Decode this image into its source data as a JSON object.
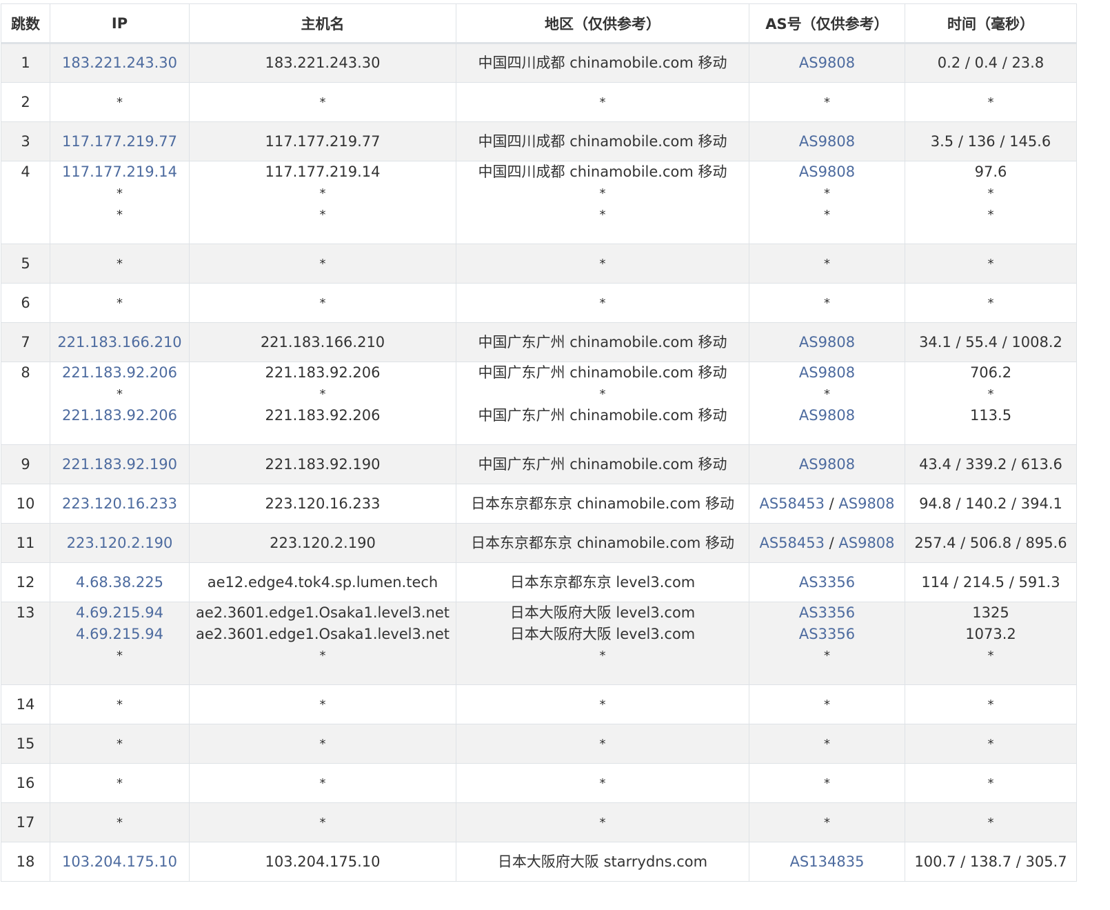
{
  "headers": [
    "跳数",
    "IP",
    "主机名",
    "地区（仅供参考）",
    "AS号（仅供参考）",
    "时间（毫秒）"
  ],
  "rows": [
    {
      "hop": "1",
      "lines": [
        {
          "ip": "183.221.243.30",
          "host": "183.221.243.30",
          "region": "中国四川成都 chinamobile.com 移动",
          "as": [
            "AS9808"
          ],
          "time": "0.2 / 0.4 / 23.8"
        }
      ]
    },
    {
      "hop": "2",
      "lines": [
        {
          "ip": "*",
          "host": "*",
          "region": "*",
          "as": [],
          "time": "*"
        }
      ]
    },
    {
      "hop": "3",
      "lines": [
        {
          "ip": "117.177.219.77",
          "host": "117.177.219.77",
          "region": "中国四川成都 chinamobile.com 移动",
          "as": [
            "AS9808"
          ],
          "time": "3.5 / 136 / 145.6"
        }
      ]
    },
    {
      "hop": "4",
      "lines": [
        {
          "ip": "117.177.219.14",
          "host": "117.177.219.14",
          "region": "中国四川成都 chinamobile.com 移动",
          "as": [
            "AS9808"
          ],
          "time": "97.6"
        },
        {
          "ip": "*",
          "host": "*",
          "region": "*",
          "as": [],
          "time": "*"
        },
        {
          "ip": "*",
          "host": "*",
          "region": "*",
          "as": [],
          "time": "*"
        }
      ]
    },
    {
      "hop": "5",
      "lines": [
        {
          "ip": "*",
          "host": "*",
          "region": "*",
          "as": [],
          "time": "*"
        }
      ]
    },
    {
      "hop": "6",
      "lines": [
        {
          "ip": "*",
          "host": "*",
          "region": "*",
          "as": [],
          "time": "*"
        }
      ]
    },
    {
      "hop": "7",
      "lines": [
        {
          "ip": "221.183.166.210",
          "host": "221.183.166.210",
          "region": "中国广东广州 chinamobile.com 移动",
          "as": [
            "AS9808"
          ],
          "time": "34.1 / 55.4 / 1008.2"
        }
      ]
    },
    {
      "hop": "8",
      "lines": [
        {
          "ip": "221.183.92.206",
          "host": "221.183.92.206",
          "region": "中国广东广州 chinamobile.com 移动",
          "as": [
            "AS9808"
          ],
          "time": "706.2"
        },
        {
          "ip": "*",
          "host": "*",
          "region": "*",
          "as": [],
          "time": "*"
        },
        {
          "ip": "221.183.92.206",
          "host": "221.183.92.206",
          "region": "中国广东广州 chinamobile.com 移动",
          "as": [
            "AS9808"
          ],
          "time": "113.5"
        }
      ]
    },
    {
      "hop": "9",
      "lines": [
        {
          "ip": "221.183.92.190",
          "host": "221.183.92.190",
          "region": "中国广东广州 chinamobile.com 移动",
          "as": [
            "AS9808"
          ],
          "time": "43.4 / 339.2 / 613.6"
        }
      ]
    },
    {
      "hop": "10",
      "lines": [
        {
          "ip": "223.120.16.233",
          "host": "223.120.16.233",
          "region": "日本东京都东京 chinamobile.com 移动",
          "as": [
            "AS58453",
            "AS9808"
          ],
          "time": "94.8 / 140.2 / 394.1"
        }
      ]
    },
    {
      "hop": "11",
      "lines": [
        {
          "ip": "223.120.2.190",
          "host": "223.120.2.190",
          "region": "日本东京都东京 chinamobile.com 移动",
          "as": [
            "AS58453",
            "AS9808"
          ],
          "time": "257.4 / 506.8 / 895.6"
        }
      ]
    },
    {
      "hop": "12",
      "lines": [
        {
          "ip": "4.68.38.225",
          "host": "ae12.edge4.tok4.sp.lumen.tech",
          "region": "日本东京都东京 level3.com",
          "as": [
            "AS3356"
          ],
          "time": "114 / 214.5 / 591.3"
        }
      ]
    },
    {
      "hop": "13",
      "lines": [
        {
          "ip": "4.69.215.94",
          "host": "ae2.3601.edge1.Osaka1.level3.net",
          "region": "日本大阪府大阪 level3.com",
          "as": [
            "AS3356"
          ],
          "time": "1325"
        },
        {
          "ip": "4.69.215.94",
          "host": "ae2.3601.edge1.Osaka1.level3.net",
          "region": "日本大阪府大阪 level3.com",
          "as": [
            "AS3356"
          ],
          "time": "1073.2"
        },
        {
          "ip": "*",
          "host": "*",
          "region": "*",
          "as": [],
          "time": "*"
        }
      ]
    },
    {
      "hop": "14",
      "lines": [
        {
          "ip": "*",
          "host": "*",
          "region": "*",
          "as": [],
          "time": "*"
        }
      ]
    },
    {
      "hop": "15",
      "lines": [
        {
          "ip": "*",
          "host": "*",
          "region": "*",
          "as": [],
          "time": "*"
        }
      ]
    },
    {
      "hop": "16",
      "lines": [
        {
          "ip": "*",
          "host": "*",
          "region": "*",
          "as": [],
          "time": "*"
        }
      ]
    },
    {
      "hop": "17",
      "lines": [
        {
          "ip": "*",
          "host": "*",
          "region": "*",
          "as": [],
          "time": "*"
        }
      ]
    },
    {
      "hop": "18",
      "lines": [
        {
          "ip": "103.204.175.10",
          "host": "103.204.175.10",
          "region": "日本大阪府大阪 starrydns.com",
          "as": [
            "AS134835"
          ],
          "time": "100.7 / 138.7 / 305.7"
        }
      ]
    }
  ],
  "as_separator": " / ",
  "empty_marker": "*",
  "colors": {
    "link": "#4d6b9f",
    "text": "#333333",
    "stripe": "#f2f2f2",
    "border": "#dee2e6"
  }
}
